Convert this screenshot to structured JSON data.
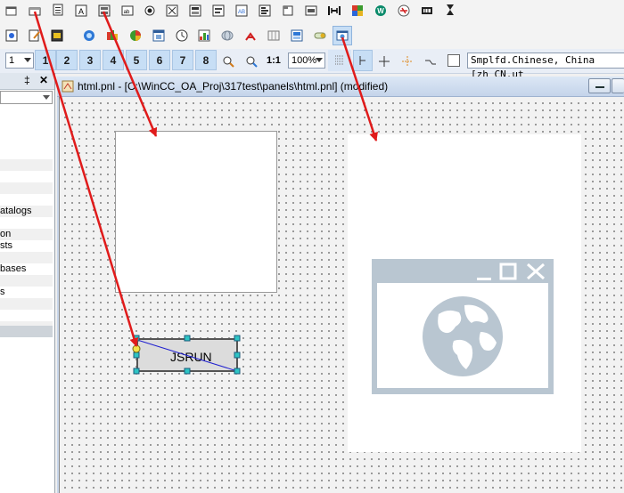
{
  "toolbar1": {
    "icons": [
      "new-icon",
      "frame-icon",
      "text-document-icon",
      "text-icon",
      "font-button-icon",
      "combobox-icon",
      "radio-icon",
      "table-icon",
      "tabs-icon",
      "textfield-icon",
      "selection-list-icon",
      "panel-icon",
      "panel-frame-icon",
      "slider-icon",
      "trend-icon",
      "widget-icon",
      "close-circle-icon",
      "dashes-icon",
      "hourglass-icon"
    ]
  },
  "toolbar2": {
    "icons": [
      "picture-icon",
      "edit-icon",
      "graphic-icon",
      "activex-icon",
      "palette-icon",
      "pie-icon",
      "window-icon",
      "clock-icon",
      "chart-icon",
      "globe-icon",
      "pipe-icon",
      "book-icon",
      "screen-icon",
      "toggle-icon",
      "webview-icon"
    ]
  },
  "layers": {
    "combo_value": "1",
    "buttons": [
      "1",
      "2",
      "3",
      "4",
      "5",
      "6",
      "7",
      "8"
    ],
    "one_to_one": "1:1",
    "zoom": "100%",
    "language": "Smplfd.Chinese, China [zh_CN.ut"
  },
  "left_panel": {
    "pin": "‡",
    "close": "✕",
    "rows": [
      {
        "text": "",
        "shade": false
      },
      {
        "text": "",
        "shade": true
      },
      {
        "text": "",
        "shade": false
      },
      {
        "text": "",
        "shade": true
      },
      {
        "text": "",
        "shade": false
      },
      {
        "text": "atalogs",
        "shade": true
      },
      {
        "text": "",
        "shade": false
      },
      {
        "text": "on",
        "shade": true
      },
      {
        "text": "sts",
        "shade": false
      },
      {
        "text": "",
        "shade": true
      },
      {
        "text": "bases",
        "shade": false
      },
      {
        "text": "",
        "shade": true
      },
      {
        "text": "s",
        "shade": false
      },
      {
        "text": "",
        "shade": true
      },
      {
        "text": "",
        "shade": false
      },
      {
        "text": "",
        "shade": true
      },
      {
        "text": "",
        "shade": false
      }
    ]
  },
  "window": {
    "title": "html.pnl - [C:\\WinCC_OA_Proj\\317test\\panels\\html.pnl] (modified)",
    "button_label": "JSRUN"
  },
  "colors": {
    "arrow": "#e01b1b",
    "canvas": "#f2f2f2",
    "placeholder": "#b9c6d1",
    "layer_button": "#c7def5"
  }
}
